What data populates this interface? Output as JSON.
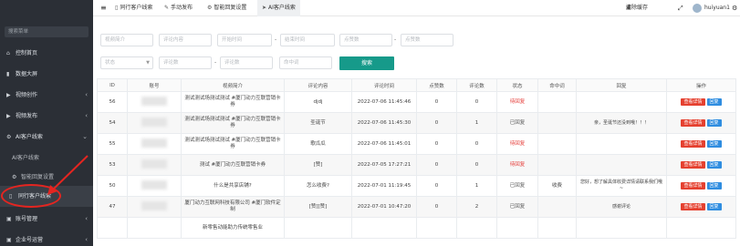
{
  "sidebar": {
    "search_placeholder": "搜索菜单",
    "items": [
      {
        "icon": "home-icon",
        "glyph": "⌂",
        "label": "控制首页",
        "arrow": ""
      },
      {
        "icon": "chart-icon",
        "glyph": "▮",
        "label": "数据大屏",
        "arrow": ""
      },
      {
        "icon": "video-icon",
        "glyph": "▶",
        "label": "视频创作",
        "arrow": "‹"
      },
      {
        "icon": "video-upload-icon",
        "glyph": "▶",
        "label": "视频发布",
        "arrow": "‹"
      },
      {
        "icon": "ai-icon",
        "glyph": "⚙",
        "label": "AI客户线索",
        "arrow": "⌄"
      }
    ],
    "subitems": [
      {
        "icon": "ai-sub-icon",
        "glyph": "",
        "label": "AI客户线索"
      },
      {
        "icon": "reply-settings-icon",
        "glyph": "⚙",
        "label": "智能回复设置"
      },
      {
        "icon": "peer-leads-icon",
        "glyph": "▯",
        "label": "同行客户线索"
      }
    ],
    "bottom_items": [
      {
        "icon": "account-icon",
        "glyph": "▣",
        "label": "账号管理",
        "arrow": "‹"
      },
      {
        "icon": "enterprise-icon",
        "glyph": "▣",
        "label": "企业号运营",
        "arrow": "‹"
      }
    ]
  },
  "topbar": {
    "menu_glyph": "≡",
    "items": [
      {
        "icon": "user-icon",
        "glyph": "▯",
        "label": "同行客户线索"
      },
      {
        "icon": "send-icon",
        "glyph": "✎",
        "label": "手动发布"
      },
      {
        "icon": "settings-icon",
        "glyph": "⚙",
        "label": "智能回复设置"
      },
      {
        "icon": "plane-icon",
        "glyph": "➤",
        "label": "AI客户线索"
      }
    ],
    "clear_cache": "清除缓存",
    "clear_glyph": "▣",
    "fullscreen_glyph": "⤢",
    "username": "huiyuan1",
    "gear_glyph": "⚙"
  },
  "filters": {
    "row1": [
      "视频简介",
      "评论内容",
      "开始时间",
      "结束时间",
      "点赞数",
      "点赞数"
    ],
    "row2": [
      "状态",
      "评论数",
      "评论数",
      "命中词"
    ],
    "dash": "-",
    "search_label": "搜索"
  },
  "table": {
    "headers": [
      "ID",
      "账号",
      "视频简介",
      "评论内容",
      "评论时间",
      "点赞数",
      "评论数",
      "状态",
      "命中词",
      "回复",
      "操作"
    ],
    "rows": [
      {
        "id": "56",
        "intro": "测试测试场测试测试 #厦门动力互联营销卡券",
        "comment": "djdj",
        "time": "2022-07-06 11:45:46",
        "likes": "0",
        "comments": "0",
        "status": "待回复",
        "status_type": "red",
        "hit": "",
        "reply": ""
      },
      {
        "id": "54",
        "intro": "测试测试场测试测试 #厦门动力互联营销卡券",
        "comment": "圣诞节",
        "time": "2022-07-06 11:45:30",
        "likes": "0",
        "comments": "1",
        "status": "已回复",
        "status_type": "gray",
        "hit": "",
        "reply": "亲，圣诞节还没到哦！！！"
      },
      {
        "id": "55",
        "intro": "测试测试场测试测试 #厦门动力互联营销卡券",
        "comment": "歌瓜瓜",
        "time": "2022-07-06 11:45:01",
        "likes": "0",
        "comments": "0",
        "status": "待回复",
        "status_type": "red",
        "hit": "",
        "reply": ""
      },
      {
        "id": "53",
        "intro": "测试 #厦门动力互联营销卡券",
        "comment": "[赞]",
        "time": "2022-07-05 17:27:21",
        "likes": "0",
        "comments": "0",
        "status": "待回复",
        "status_type": "red",
        "hit": "",
        "reply": ""
      },
      {
        "id": "50",
        "intro": "什么是共享店铺?",
        "comment": "怎么收费?",
        "time": "2022-07-01 11:19:45",
        "likes": "0",
        "comments": "1",
        "status": "已回复",
        "status_type": "gray",
        "hit": "收费",
        "reply": "您好，想了解具体收费详情请联系我们哦~"
      },
      {
        "id": "47",
        "intro": "厦门动力互联网科技有限公司 #厦门软件定制",
        "comment": "[赞][赞]",
        "time": "2022-07-01 10:47:20",
        "likes": "0",
        "comments": "2",
        "status": "已回复",
        "status_type": "gray",
        "hit": "",
        "reply": "感谢评论"
      },
      {
        "id": "",
        "intro": "新零售动能助力传统零售业",
        "comment": "",
        "time": "",
        "likes": "",
        "comments": "",
        "status": "",
        "status_type": "gray",
        "hit": "",
        "reply": ""
      }
    ],
    "action_detail": "查看详情",
    "action_reply": "回复"
  }
}
